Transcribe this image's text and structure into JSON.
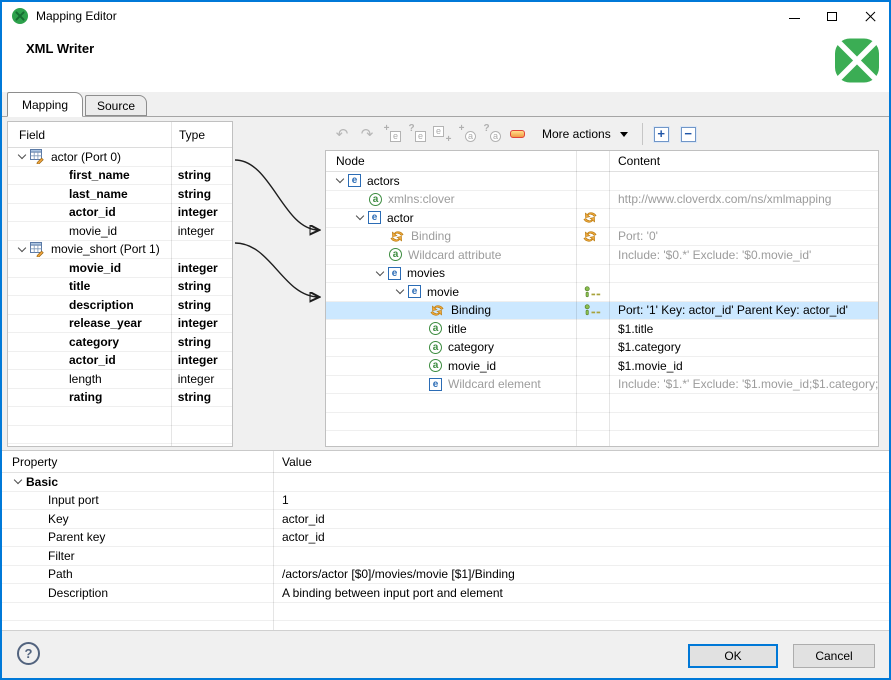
{
  "window": {
    "title": "Mapping Editor"
  },
  "header": {
    "title": "XML Writer"
  },
  "tabs": [
    {
      "label": "Mapping",
      "active": true
    },
    {
      "label": "Source",
      "active": false
    }
  ],
  "field_table": {
    "columns": [
      "Field",
      "Type"
    ],
    "rows": [
      {
        "label": "actor (Port 0)",
        "type": "",
        "kind": "port",
        "bold": false
      },
      {
        "label": "first_name",
        "type": "string",
        "kind": "field",
        "bold": true
      },
      {
        "label": "last_name",
        "type": "string",
        "kind": "field",
        "bold": true
      },
      {
        "label": "actor_id",
        "type": "integer",
        "kind": "field",
        "bold": true
      },
      {
        "label": "movie_id",
        "type": "integer",
        "kind": "field",
        "bold": false
      },
      {
        "label": "movie_short (Port 1)",
        "type": "",
        "kind": "port",
        "bold": false
      },
      {
        "label": "movie_id",
        "type": "integer",
        "kind": "field",
        "bold": true
      },
      {
        "label": "title",
        "type": "string",
        "kind": "field",
        "bold": true
      },
      {
        "label": "description",
        "type": "string",
        "kind": "field",
        "bold": true
      },
      {
        "label": "release_year",
        "type": "integer",
        "kind": "field",
        "bold": true
      },
      {
        "label": "category",
        "type": "string",
        "kind": "field",
        "bold": true
      },
      {
        "label": "actor_id",
        "type": "integer",
        "kind": "field",
        "bold": true
      },
      {
        "label": "length",
        "type": "integer",
        "kind": "field",
        "bold": false
      },
      {
        "label": "rating",
        "type": "string",
        "kind": "field",
        "bold": true
      }
    ],
    "empty_rows": 3
  },
  "toolbar": {
    "icons": [
      "undo",
      "redo",
      "add-child-element",
      "add-wildcard-element",
      "append-element",
      "add-attribute",
      "add-wildcard-attribute",
      "remove"
    ],
    "more_actions_label": "More actions"
  },
  "tree_table": {
    "columns": [
      "Node",
      "Content"
    ],
    "rows": [
      {
        "label": "actors",
        "icon": "element",
        "indent": 0,
        "chevron": true,
        "gray": false,
        "status": "",
        "content": "",
        "content_gray": false,
        "selected": false
      },
      {
        "label": "xmlns:clover",
        "icon": "attribute",
        "indent": 1,
        "chevron": false,
        "gray": true,
        "status": "",
        "content": "http://www.cloverdx.com/ns/xmlmapping",
        "content_gray": true,
        "selected": false
      },
      {
        "label": "actor",
        "icon": "element",
        "indent": 1,
        "chevron": true,
        "gray": false,
        "status": "binding",
        "content": "",
        "content_gray": false,
        "selected": false
      },
      {
        "label": "Binding",
        "icon": "binding",
        "indent": 2,
        "chevron": false,
        "gray": true,
        "status": "binding",
        "content": "Port: '0'",
        "content_gray": true,
        "selected": false
      },
      {
        "label": "Wildcard attribute",
        "icon": "attribute",
        "indent": 2,
        "chevron": false,
        "gray": true,
        "status": "",
        "content": "Include: '$0.*' Exclude: '$0.movie_id'",
        "content_gray": true,
        "selected": false
      },
      {
        "label": "movies",
        "icon": "element",
        "indent": 2,
        "chevron": true,
        "gray": false,
        "status": "",
        "content": "",
        "content_gray": false,
        "selected": false
      },
      {
        "label": "movie",
        "icon": "element",
        "indent": 3,
        "chevron": true,
        "gray": false,
        "status": "join",
        "content": "",
        "content_gray": false,
        "selected": false
      },
      {
        "label": "Binding",
        "icon": "binding",
        "indent": 4,
        "chevron": false,
        "gray": false,
        "status": "join",
        "content": "Port: '1' Key: actor_id' Parent Key: actor_id'",
        "content_gray": false,
        "selected": true
      },
      {
        "label": "title",
        "icon": "attribute",
        "indent": 4,
        "chevron": false,
        "gray": false,
        "status": "",
        "content": "$1.title",
        "content_gray": false,
        "selected": false
      },
      {
        "label": "category",
        "icon": "attribute",
        "indent": 4,
        "chevron": false,
        "gray": false,
        "status": "",
        "content": "$1.category",
        "content_gray": false,
        "selected": false
      },
      {
        "label": "movie_id",
        "icon": "attribute",
        "indent": 4,
        "chevron": false,
        "gray": false,
        "status": "",
        "content": "$1.movie_id",
        "content_gray": false,
        "selected": false
      },
      {
        "label": "Wildcard element",
        "icon": "element",
        "indent": 4,
        "chevron": false,
        "gray": true,
        "status": "",
        "content": "Include: '$1.*' Exclude: '$1.movie_id;$1.category;...",
        "content_gray": true,
        "selected": false
      }
    ],
    "empty_rows": 3
  },
  "property_table": {
    "columns": [
      "Property",
      "Value"
    ],
    "group_label": "Basic",
    "rows": [
      {
        "label": "Input port",
        "value": "1"
      },
      {
        "label": "Key",
        "value": "actor_id"
      },
      {
        "label": "Parent key",
        "value": "actor_id"
      },
      {
        "label": "Filter",
        "value": ""
      },
      {
        "label": "Path",
        "value": "/actors/actor [$0]/movies/movie [$1]/Binding"
      },
      {
        "label": "Description",
        "value": "A binding between input port and element"
      }
    ]
  },
  "footer": {
    "help_label": "?",
    "ok_label": "OK",
    "cancel_label": "Cancel"
  }
}
